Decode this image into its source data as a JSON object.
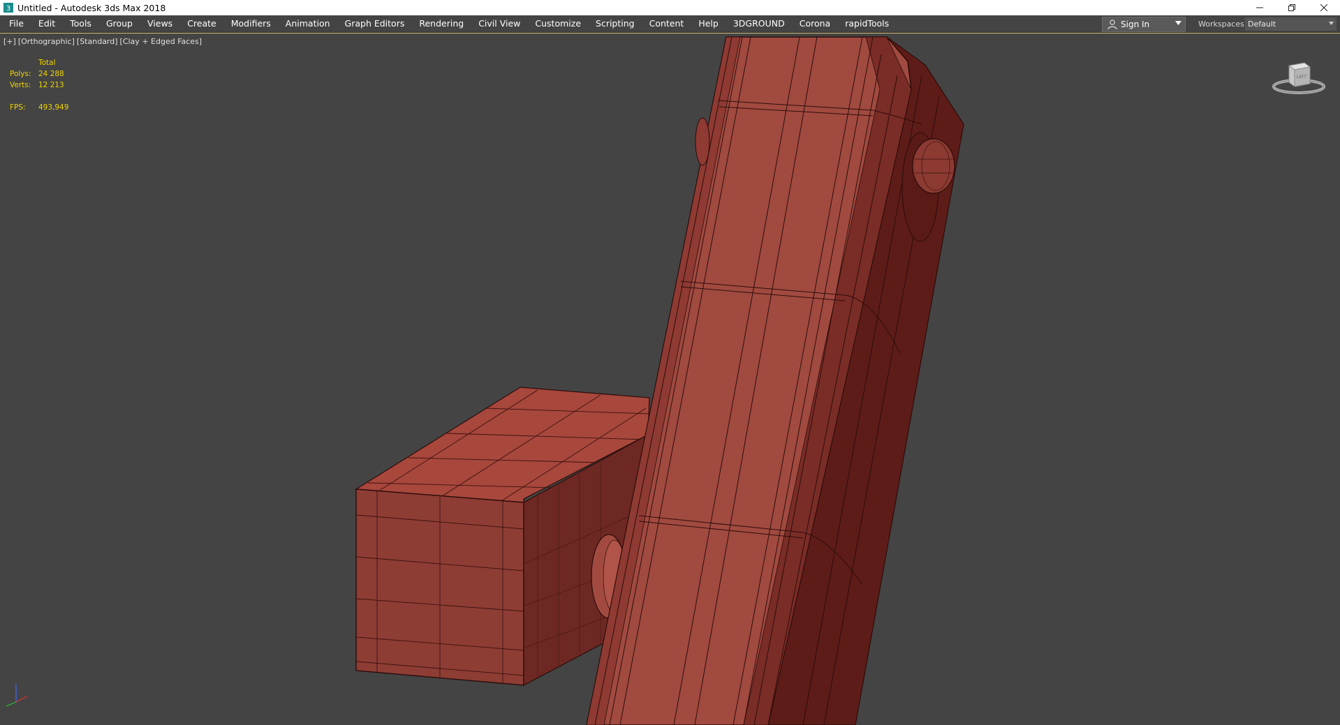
{
  "window": {
    "title": "Untitled - Autodesk 3ds Max 2018",
    "controls": [
      "minimize-icon",
      "restore-icon",
      "close-icon"
    ]
  },
  "menu": {
    "items": [
      "File",
      "Edit",
      "Tools",
      "Group",
      "Views",
      "Create",
      "Modifiers",
      "Animation",
      "Graph Editors",
      "Rendering",
      "Civil View",
      "Customize",
      "Scripting",
      "Content",
      "Help",
      "3DGROUND",
      "Corona",
      "rapidTools"
    ]
  },
  "account": {
    "sign_in_label": "Sign In",
    "workspaces_label": "Workspaces:",
    "workspace_value": "Default"
  },
  "viewport": {
    "label_plus": "[+]",
    "label_view": "[Orthographic]",
    "label_shading": "[Standard]",
    "label_mode": "[Clay + Edged Faces]",
    "stats": {
      "total_label": "Total",
      "polys_label": "Polys:",
      "polys_value": "24 288",
      "verts_label": "Verts:",
      "verts_value": "12 213",
      "fps_label": "FPS:",
      "fps_value": "493,949"
    }
  },
  "colors": {
    "viewport_bg": "#444444",
    "model_face": "#a14a40",
    "model_dark": "#6b2420",
    "stats_text": "#f0d400"
  }
}
